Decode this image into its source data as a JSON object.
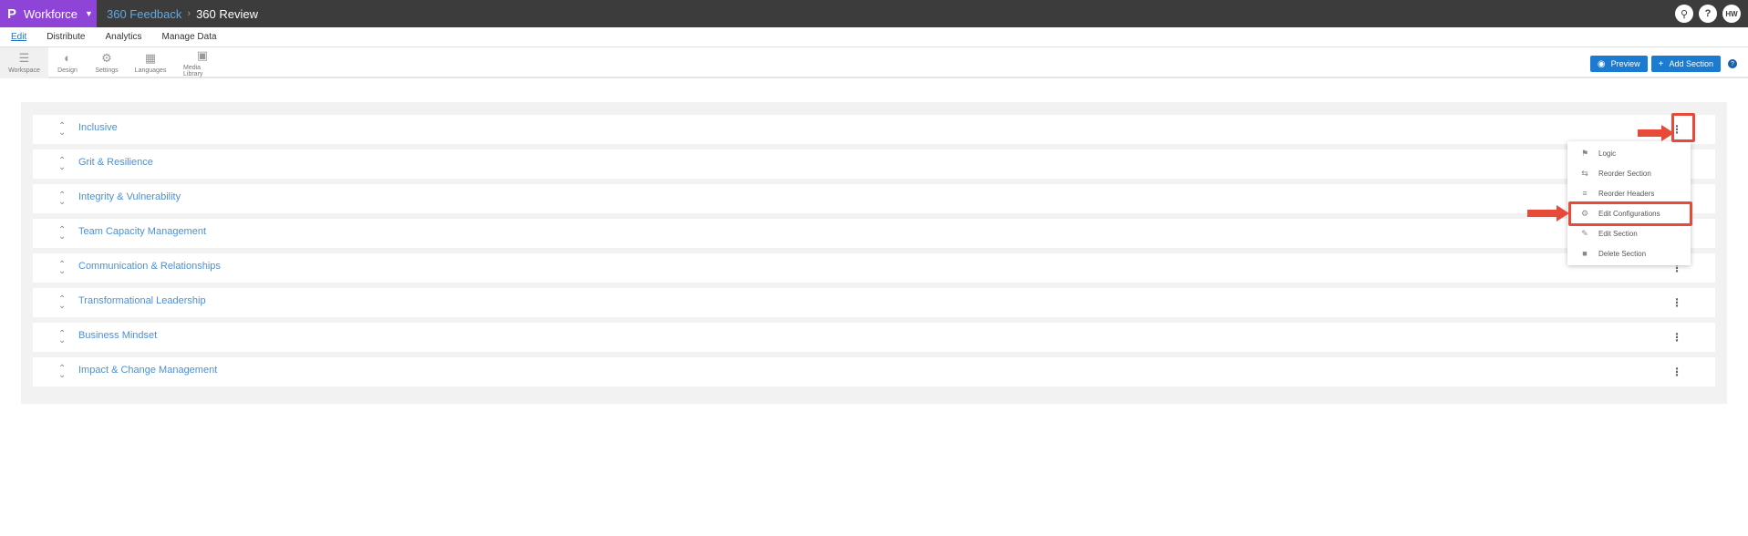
{
  "topbar": {
    "product": "Workforce",
    "breadcrumb_link": "360 Feedback",
    "breadcrumb_current": "360 Review",
    "avatar_initials": "HW"
  },
  "menubar": {
    "items": [
      "Edit",
      "Distribute",
      "Analytics",
      "Manage Data"
    ]
  },
  "toolbar": {
    "tools": [
      "Workspace",
      "Design",
      "Settings",
      "Languages",
      "Media Library"
    ],
    "preview_label": "Preview",
    "add_section_label": "Add Section"
  },
  "sections": [
    "Inclusive",
    "Grit & Resilience",
    "Integrity & Vulnerability",
    "Team Capacity Management",
    "Communication & Relationships",
    "Transformational Leadership",
    "Business Mindset",
    "Impact & Change Management"
  ],
  "dropdown": {
    "items": [
      "Logic",
      "Reorder Section",
      "Reorder Headers",
      "Edit Configurations",
      "Edit Section",
      "Delete Section"
    ]
  },
  "colors": {
    "product_bg": "#8e44d6",
    "topbar_bg": "#3c3c3c",
    "accent_blue": "#1a7bd1",
    "highlight_red": "#e84a3a"
  }
}
